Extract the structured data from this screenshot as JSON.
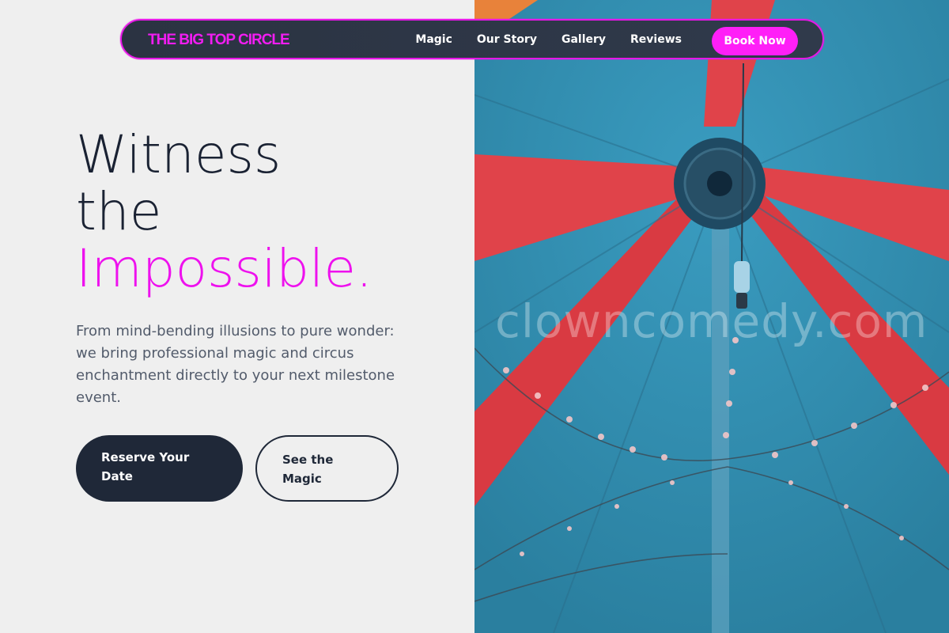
{
  "nav": {
    "brand": "THE BIG TOP CIRCLE",
    "links": [
      "Magic",
      "Our Story",
      "Gallery",
      "Reviews"
    ],
    "cta": "Book Now"
  },
  "hero": {
    "line1": "Witness",
    "line2": "the",
    "line3": "Impossible.",
    "description": "From mind-bending illusions to pure wonder: we bring professional magic and circus enchantment directly to your next milestone event.",
    "primary_button": "Reserve Your Date",
    "secondary_button": "See the Magic"
  },
  "image": {
    "watermark": "clowncomedy.com"
  },
  "colors": {
    "accent": "#ee11ee",
    "dark": "#1f2838",
    "background": "#efefef",
    "tent_blue": "#2f8fb0",
    "tent_red": "#e0434a"
  }
}
